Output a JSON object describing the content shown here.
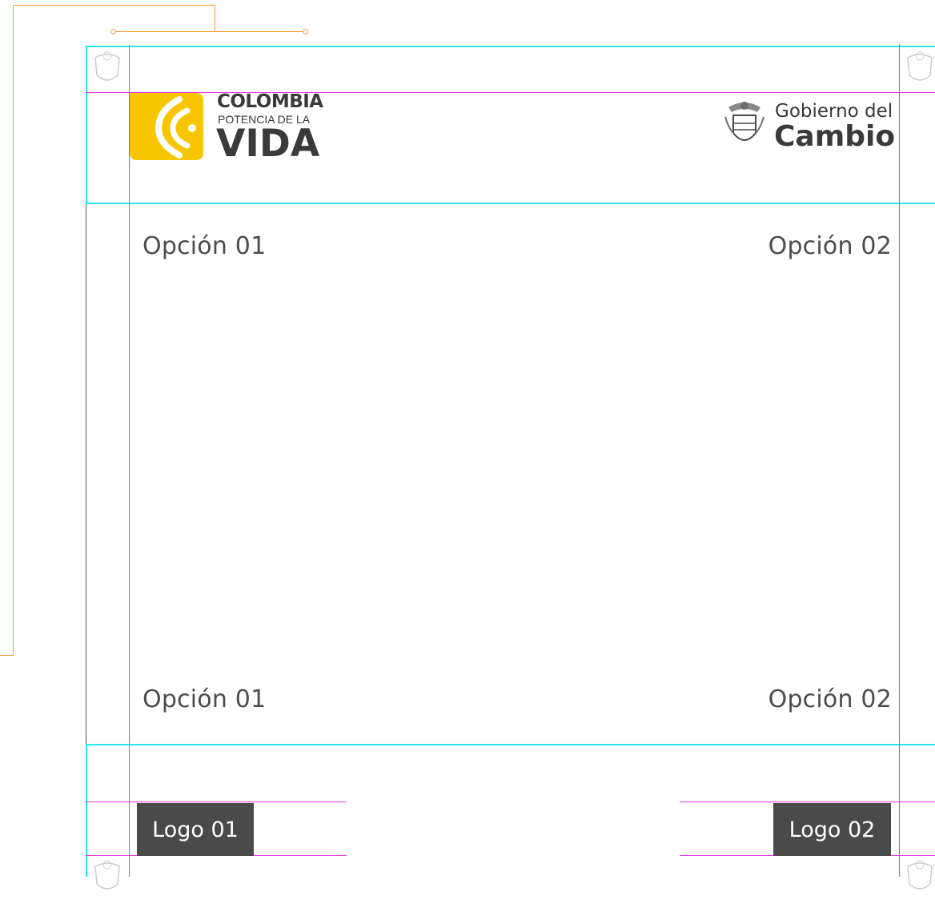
{
  "brand_left": {
    "line1": "COLOMBIA",
    "line2": "POTENCIA DE LA",
    "line3": "VIDA",
    "accent_color": "#f8c600"
  },
  "brand_right": {
    "line1": "Gobierno del",
    "line2": "Cambio",
    "icon": "coat-of-arms-icon"
  },
  "options": {
    "top_left": "Opción 01",
    "top_right": "Opción 02",
    "bottom_left": "Opción 01",
    "bottom_right": "Opción 02"
  },
  "footer": {
    "logo_left": "Logo 01",
    "logo_right": "Logo 02"
  },
  "colors": {
    "guide_magenta": "#e233e2",
    "frame_cyan": "#29e6ec",
    "orange_line": "#f29a2e",
    "logo_box": "#4a4a4a",
    "text_dark": "#4d4d4d"
  }
}
